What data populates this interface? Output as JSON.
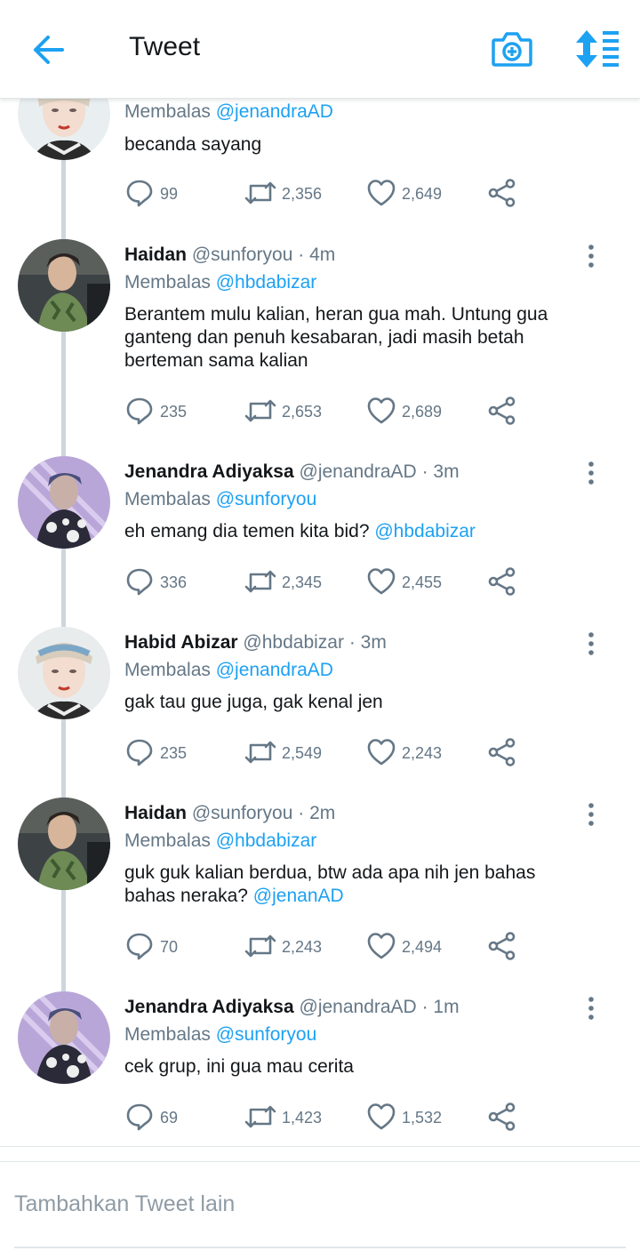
{
  "header": {
    "title": "Tweet",
    "back_icon": "arrow-left-icon",
    "camera_icon": "camera-add-icon",
    "sort_icon": "sort-icon",
    "accent_color": "#1da1f2"
  },
  "reply_label": "Membalas",
  "tweets": [
    {
      "name": "",
      "handle": "",
      "time": "",
      "reply_to": "@jenandraAD",
      "text": "becanda sayang",
      "text_mention": "",
      "replies": "99",
      "retweets": "2,356",
      "likes": "2,649"
    },
    {
      "name": "Haidan",
      "handle": "@sunforyou",
      "time": "4m",
      "reply_to": "@hbdabizar",
      "text": "Berantem mulu kalian, heran gua mah. Untung gua ganteng dan penuh kesabaran, jadi masih betah berteman sama kalian",
      "text_mention": "",
      "replies": "235",
      "retweets": "2,653",
      "likes": "2,689"
    },
    {
      "name": "Jenandra Adiyaksa",
      "handle": "@jenandraAD",
      "time": "3m",
      "reply_to": "@sunforyou",
      "text": "eh emang dia temen kita bid?",
      "text_mention": "@hbdabizar",
      "replies": "336",
      "retweets": "2,345",
      "likes": "2,455"
    },
    {
      "name": "Habid Abizar",
      "handle": "@hbdabizar",
      "time": "3m",
      "reply_to": "@jenandraAD",
      "text": "gak tau gue juga, gak kenal jen",
      "text_mention": "",
      "replies": "235",
      "retweets": "2,549",
      "likes": "2,243"
    },
    {
      "name": "Haidan",
      "handle": "@sunforyou",
      "time": "2m",
      "reply_to": "@hbdabizar",
      "text": "guk guk kalian berdua, btw ada apa nih jen bahas bahas neraka?",
      "text_mention": "@jenanAD",
      "replies": "70",
      "retweets": "2,243",
      "likes": "2,494"
    },
    {
      "name": "Jenandra Adiyaksa",
      "handle": "@jenandraAD",
      "time": "1m",
      "reply_to": "@sunforyou",
      "text": "cek grup, ini gua mau cerita",
      "text_mention": "",
      "replies": "69",
      "retweets": "1,423",
      "likes": "1,532"
    }
  ],
  "compose": {
    "placeholder": "Tambahkan Tweet lain"
  }
}
